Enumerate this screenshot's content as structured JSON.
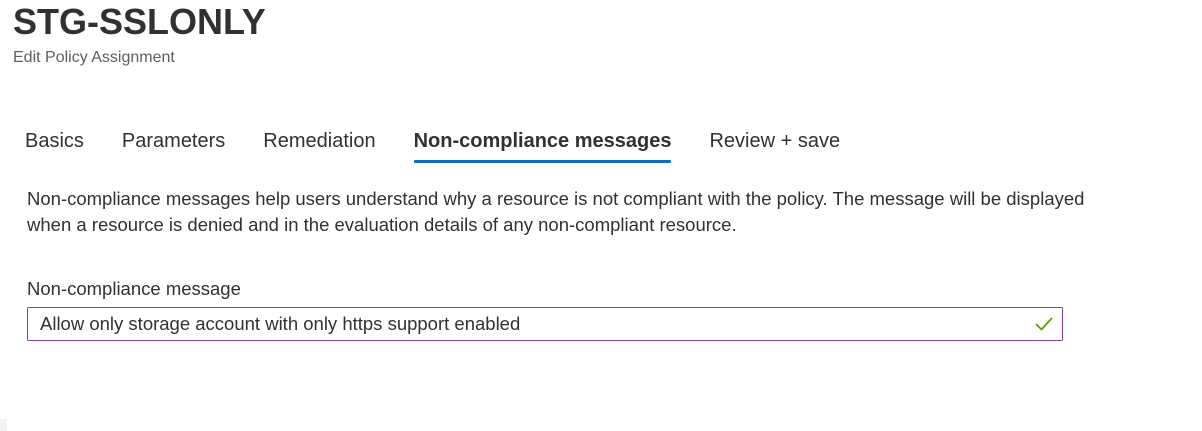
{
  "header": {
    "title": "STG-SSLONLY",
    "subtitle": "Edit Policy Assignment"
  },
  "tabs": [
    {
      "label": "Basics",
      "selected": false
    },
    {
      "label": "Parameters",
      "selected": false
    },
    {
      "label": "Remediation",
      "selected": false
    },
    {
      "label": "Non-compliance messages",
      "selected": true
    },
    {
      "label": "Review + save",
      "selected": false
    }
  ],
  "content": {
    "description": "Non-compliance messages help users understand why a resource is not compliant with the policy. The message will be displayed when a resource is denied and in the evaluation details of any non-compliant resource.",
    "field_label": "Non-compliance message",
    "field_value": "Allow only storage account with only https support enabled",
    "validation_icon": "checkmark-icon"
  },
  "colors": {
    "accent_tab_underline": "#0f6cbd",
    "input_border": "#8a3aa6",
    "valid_check": "#57a300"
  }
}
